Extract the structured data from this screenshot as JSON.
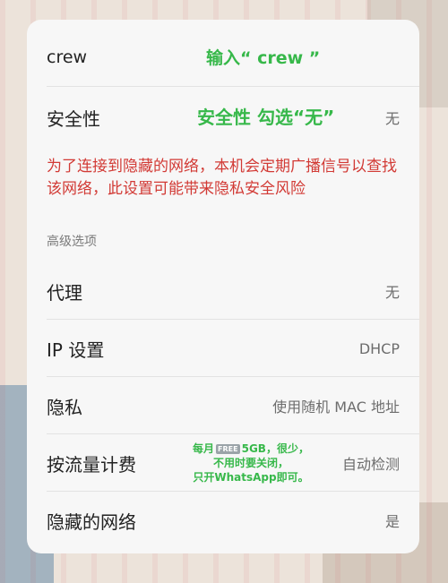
{
  "rows": {
    "ssid": {
      "label": "crew",
      "annotation": "输入“ crew ”"
    },
    "security": {
      "label": "安全性",
      "annotation": "安全性 勾选“无”",
      "value": "无"
    },
    "proxy": {
      "label": "代理",
      "value": "无"
    },
    "ip": {
      "label": "IP 设置",
      "value": "DHCP"
    },
    "privacy": {
      "label": "隐私",
      "value": "使用随机 MAC 地址"
    },
    "metered": {
      "label": "按流量计费",
      "value": "自动检测",
      "annotation": {
        "line1_pre": "每月",
        "badge": "FREE",
        "line1_post": "5GB，很少，",
        "line2": "不用时要关闭，",
        "line3": "只开WhatsApp即可。"
      }
    },
    "hidden": {
      "label": "隐藏的网络",
      "value": "是"
    }
  },
  "warning": "为了连接到隐藏的网络，本机会定期广播信号以查找该网络，此设置可能带来隐私安全风险",
  "advanced_section": "高级选项",
  "colors": {
    "annotation": "#37b84a",
    "warning": "#d23a35",
    "card": "#f7f7f7"
  }
}
